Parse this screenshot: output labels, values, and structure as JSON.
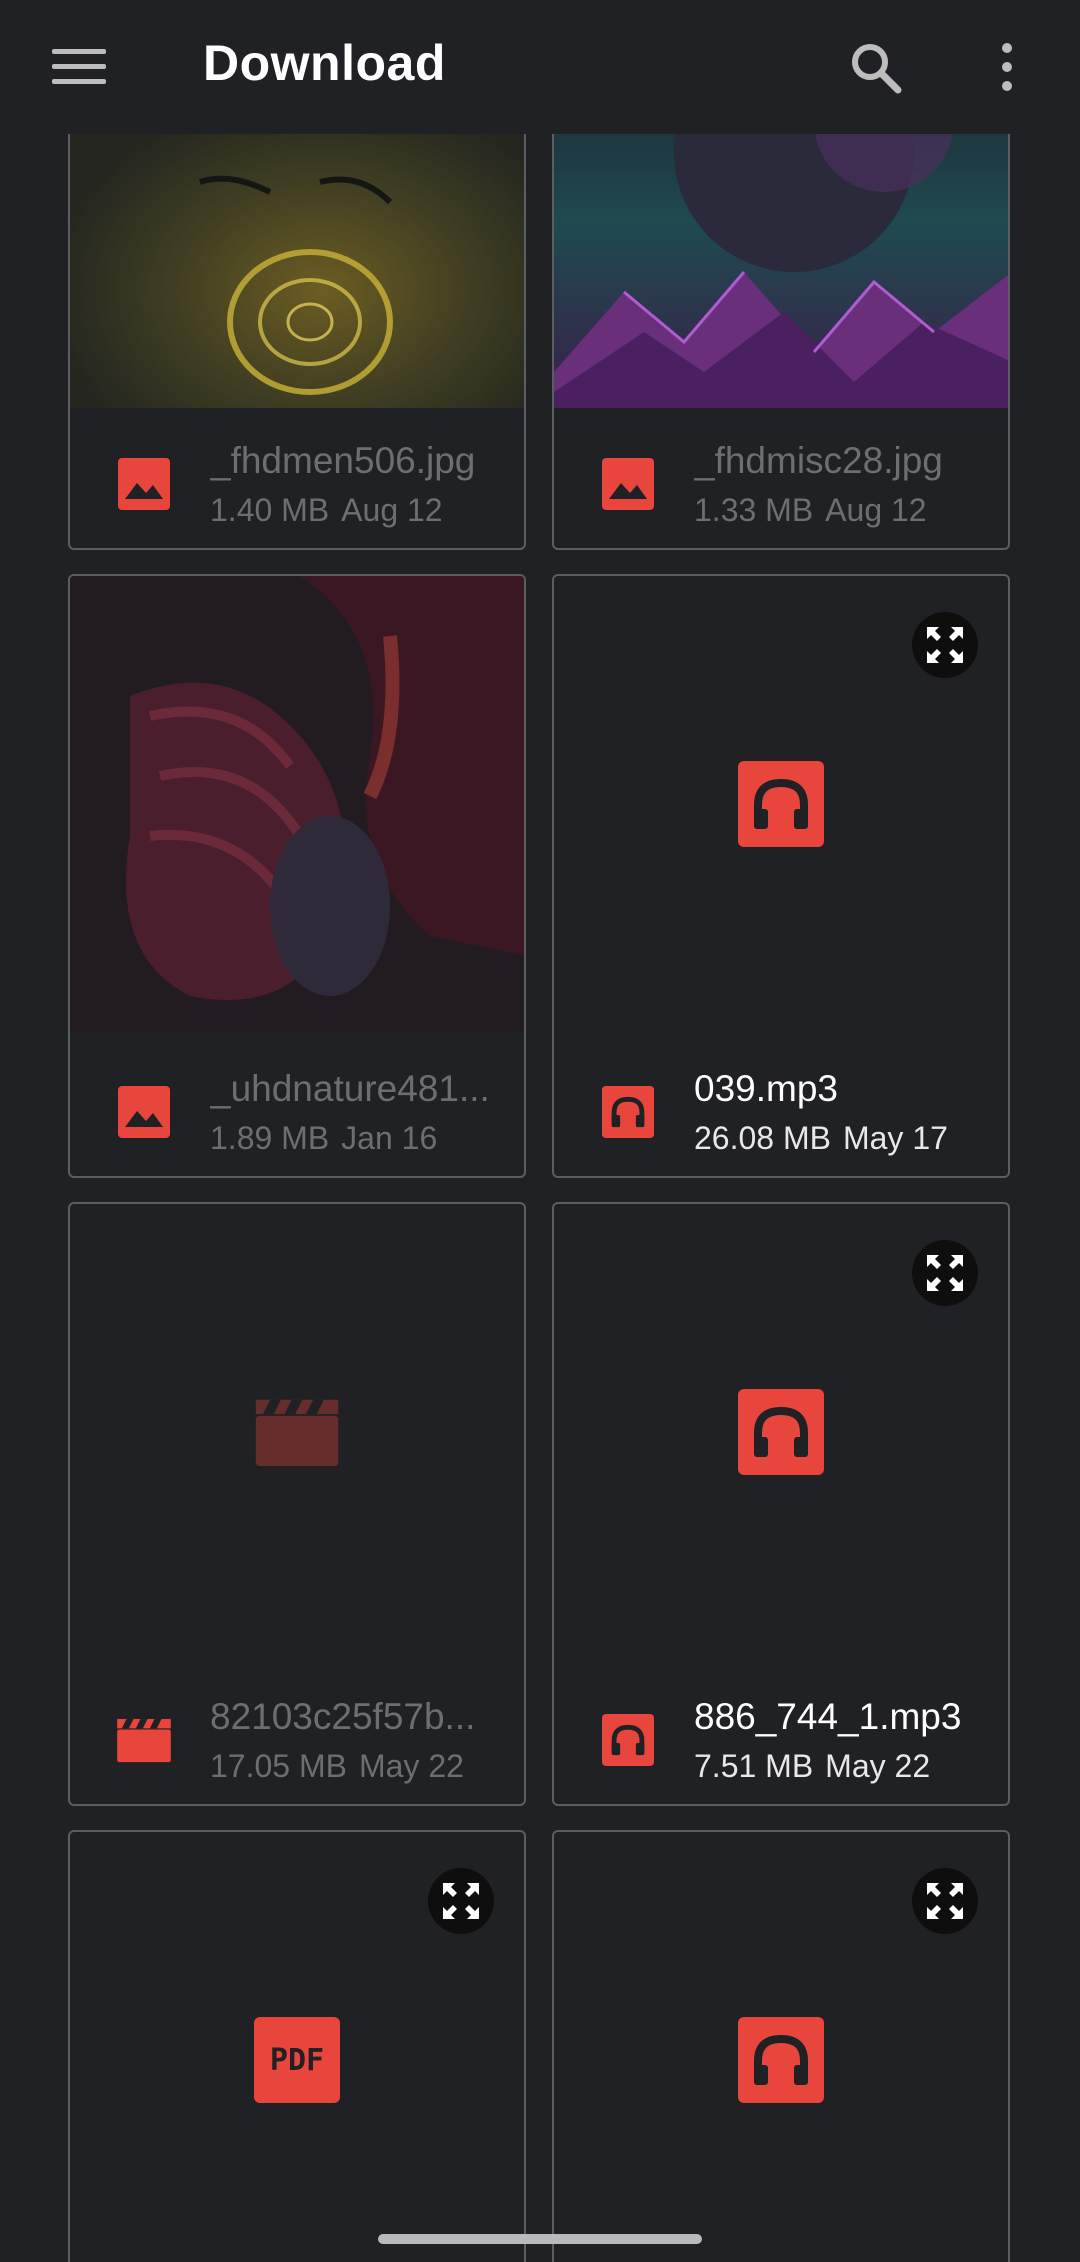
{
  "header": {
    "title": "Download",
    "menu_icon": "hamburger-menu-icon",
    "search_icon": "search-icon",
    "more_icon": "more-vertical-icon"
  },
  "colors": {
    "background": "#202124",
    "card_border": "#5c5d60",
    "accent_red": "#e8453c",
    "dim_text": "#6d6e71",
    "text": "#ffffff"
  },
  "files": [
    {
      "name": "_fhdmen506.jpg",
      "size": "1.40 MB",
      "date": "Aug 12",
      "type": "image",
      "dimmed": true
    },
    {
      "name": "_fhdmisc28.jpg",
      "size": "1.33 MB",
      "date": "Aug 12",
      "type": "image",
      "dimmed": true
    },
    {
      "name": "_uhdnature481...",
      "size": "1.89 MB",
      "date": "Jan 16",
      "type": "image",
      "dimmed": true
    },
    {
      "name": "039.mp3",
      "size": "26.08 MB",
      "date": "May 17",
      "type": "audio",
      "dimmed": false
    },
    {
      "name": "82103c25f57b...",
      "size": "17.05 MB",
      "date": "May 22",
      "type": "video",
      "dimmed": true
    },
    {
      "name": "886_744_1.mp3",
      "size": "7.51 MB",
      "date": "May 22",
      "type": "audio",
      "dimmed": false
    },
    {
      "name": "",
      "size": "",
      "date": "",
      "type": "pdf",
      "dimmed": false
    },
    {
      "name": "",
      "size": "",
      "date": "",
      "type": "audio",
      "dimmed": false
    }
  ],
  "pdf_label": "PDF"
}
